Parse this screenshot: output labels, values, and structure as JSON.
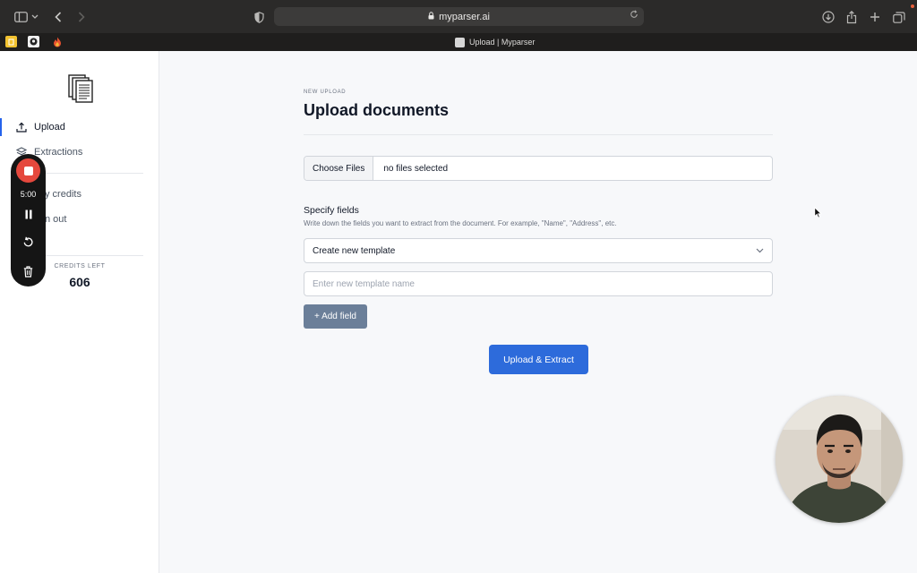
{
  "browser": {
    "url": "myparser.ai",
    "tab_title": "Upload | Myparser"
  },
  "sidebar": {
    "items": [
      {
        "label": "Upload",
        "icon": "upload-icon",
        "active": true
      },
      {
        "label": "Extractions",
        "icon": "layers-icon",
        "active": false
      },
      {
        "label": "y credits",
        "icon": "credit-icon",
        "active": false
      },
      {
        "label": "n out",
        "icon": "logout-icon",
        "active": false
      }
    ],
    "credits_label": "CREDITS LEFT",
    "credits_value": "606"
  },
  "recorder": {
    "time": "5:00",
    "stop_color": "#e5483d"
  },
  "main": {
    "eyebrow": "NEW UPLOAD",
    "title": "Upload documents",
    "file_button": "Choose Files",
    "file_status": "no files selected",
    "fields_title": "Specify fields",
    "fields_help": "Write down the fields you want to extract from the document. For example, \"Name\", \"Address\", etc.",
    "template_select": "Create new template",
    "template_name_placeholder": "Enter new template name",
    "add_field_label": "+ Add field",
    "submit_label": "Upload & Extract"
  },
  "colors": {
    "accent": "#2d6bdb",
    "secondary_button": "#6b7f99",
    "active_nav_bar": "#2563eb"
  }
}
